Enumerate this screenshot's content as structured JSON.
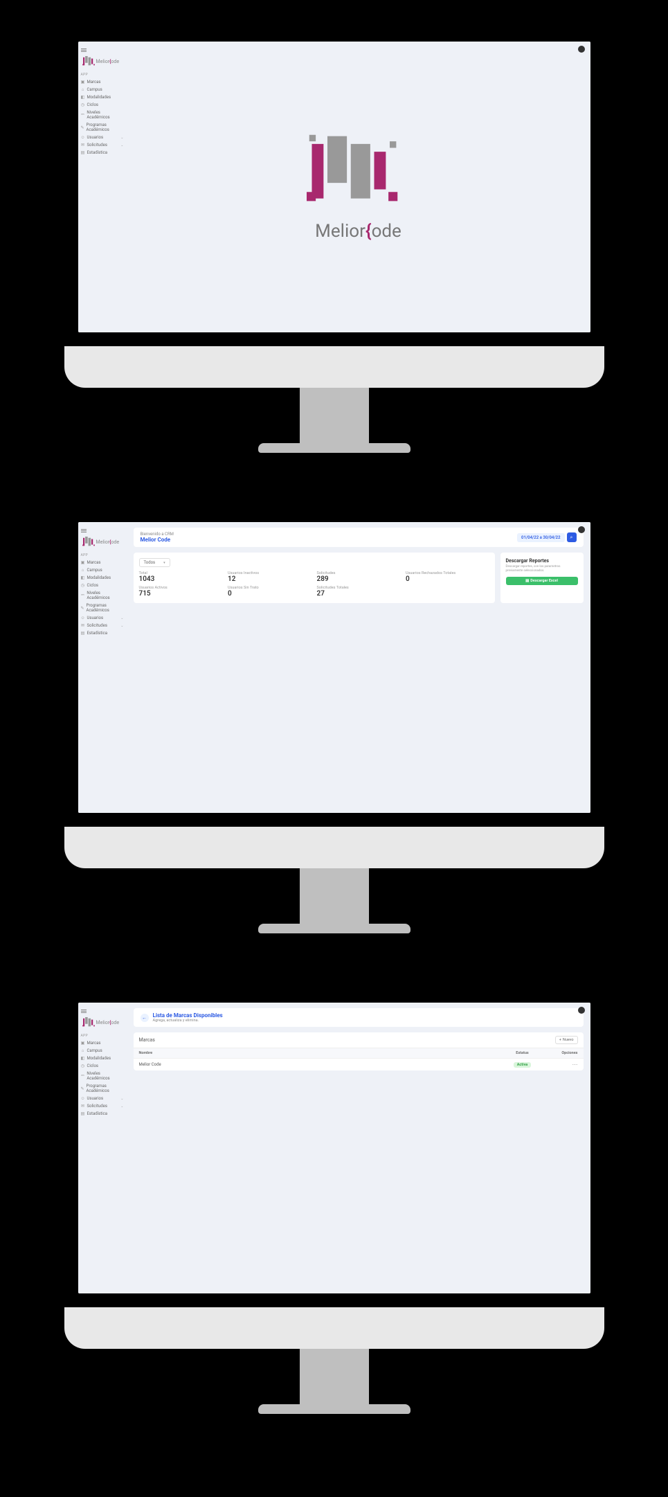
{
  "brand": {
    "name_plain": "Melior",
    "name_suffix": "ode",
    "brace": "{"
  },
  "sidebar": {
    "section_label": "APP",
    "items": [
      {
        "label": "Marcas",
        "icon": "brand-icon",
        "expandable": false
      },
      {
        "label": "Campus",
        "icon": "campus-icon",
        "expandable": false
      },
      {
        "label": "Modalidades",
        "icon": "modes-icon",
        "expandable": false
      },
      {
        "label": "Ciclos",
        "icon": "cycles-icon",
        "expandable": false
      },
      {
        "label": "Niveles Académicos",
        "icon": "levels-icon",
        "expandable": false
      },
      {
        "label": "Programas Académicos",
        "icon": "programs-icon",
        "expandable": false
      },
      {
        "label": "Usuarios",
        "icon": "users-icon",
        "expandable": true
      },
      {
        "label": "Solicitudes",
        "icon": "requests-icon",
        "expandable": true
      },
      {
        "label": "Estadística",
        "icon": "stats-icon",
        "expandable": false
      }
    ]
  },
  "screen2": {
    "welcome": "Bienvenido a CRM",
    "title": "Melior Code",
    "date_range": "01/04/22 a 30/04/22",
    "filter_label": "Todos",
    "stats": [
      {
        "label": "Total",
        "value": "1043"
      },
      {
        "label": "Usuarios Inactivos",
        "value": "12"
      },
      {
        "label": "Solicitudes",
        "value": "289"
      },
      {
        "label": "Usuarios Rechazados Totales",
        "value": "0"
      },
      {
        "label": "Usuarios Activos",
        "value": "715"
      },
      {
        "label": "Usuarios Sin Trato",
        "value": "0"
      },
      {
        "label": "Solicitudes Totales",
        "value": "27"
      }
    ],
    "reports": {
      "title": "Descargar Reportes",
      "desc": "Descargar reportes, con los parametros previamente seleccionados.",
      "button": "Descargar Excel"
    }
  },
  "screen3": {
    "header_title": "Lista de Marcas Disponibles",
    "header_sub": "Agrega, actualiza y elimina.",
    "table_title": "Marcas",
    "new_button": "Nuevo",
    "columns": {
      "name": "Nombre",
      "status": "Estatus",
      "options": "Opciones"
    },
    "rows": [
      {
        "name": "Melior Code",
        "status": "Activa"
      }
    ]
  }
}
